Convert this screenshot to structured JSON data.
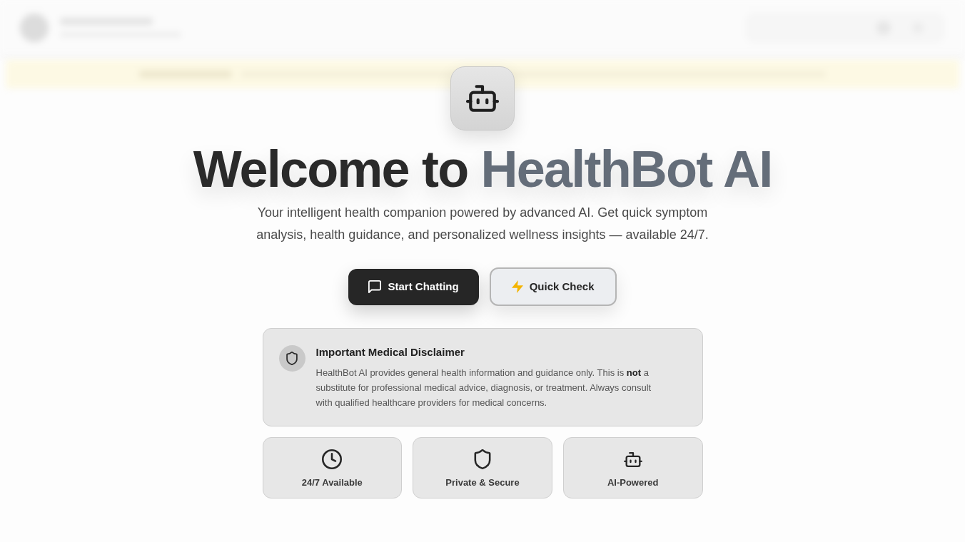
{
  "hero": {
    "title": "Welcome to",
    "title_highlight": "HealthBot AI",
    "subtitle": "Your intelligent health companion powered by advanced AI. Get quick symptom analysis, health guidance, and personalized wellness insights — available 24/7."
  },
  "actions": [
    {
      "label": "Start Chatting",
      "kind": "primary"
    },
    {
      "label": "Quick Check",
      "kind": "secondary"
    }
  ],
  "disclaimer": {
    "title": "Important Medical Disclaimer",
    "text": "HealthBot AI provides general health information and guidance only. This is **not** a substitute for professional medical advice, diagnosis, or treatment. Always consult with qualified healthcare providers for medical concerns."
  },
  "features": [
    {
      "label": "24/7 Available"
    },
    {
      "label": "Private & Secure"
    },
    {
      "label": "AI-Powered"
    }
  ]
}
